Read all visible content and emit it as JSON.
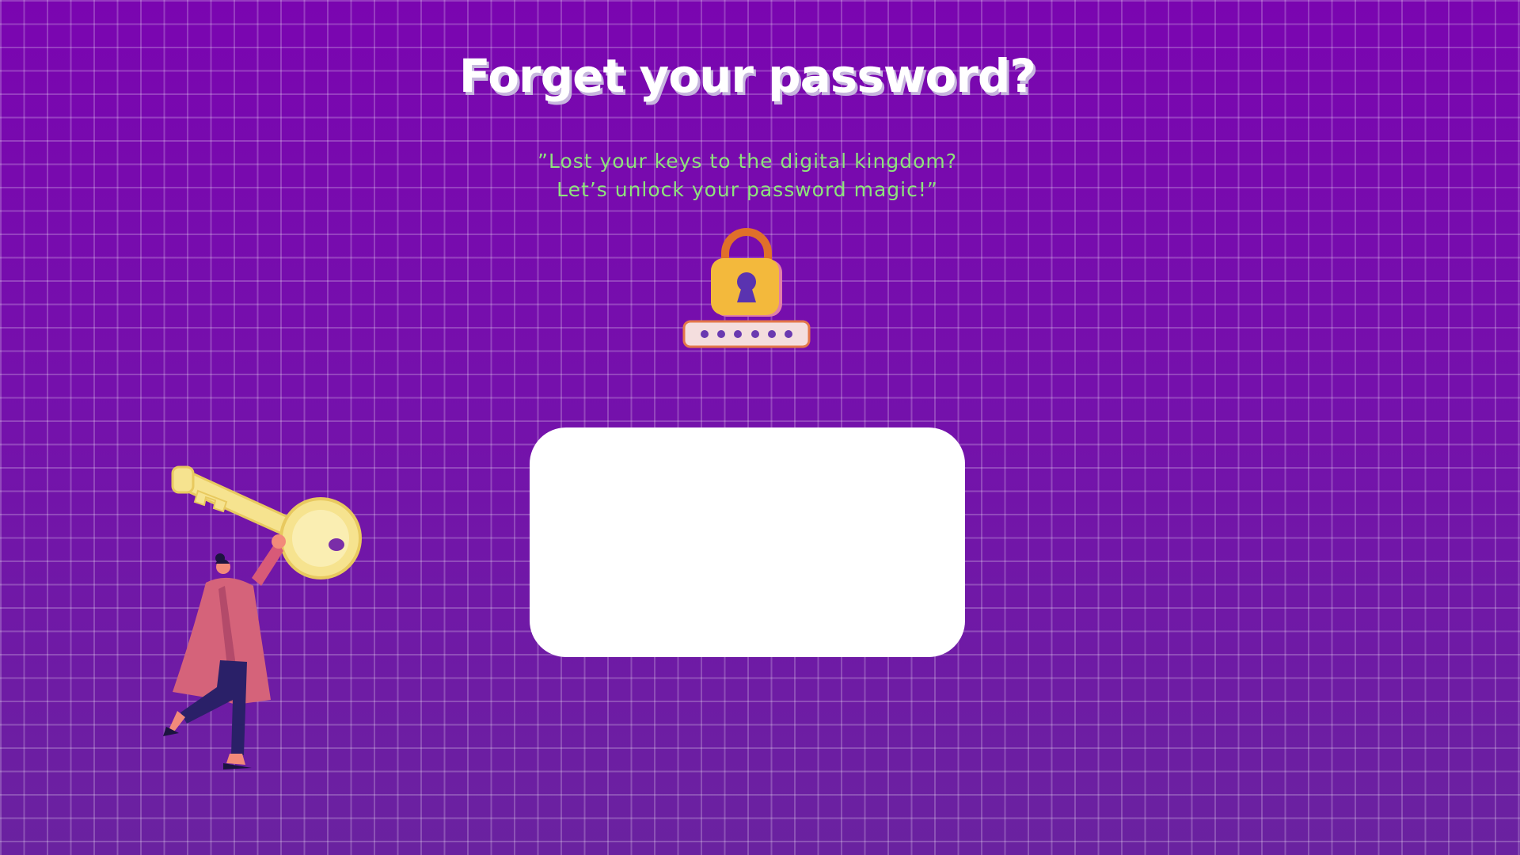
{
  "page": {
    "title": "Forget your password?",
    "subtitle_line1": "”Lost your keys to the digital kingdom?",
    "subtitle_line2": "Let’s unlock your password magic!”"
  },
  "icons": {
    "lock": "padlock-icon",
    "password_dots": "password-field-icon",
    "illustration": "person-carrying-key-illustration"
  },
  "colors": {
    "background": "#7a05b0",
    "title": "#ffffff",
    "subtitle": "#8ee27c",
    "lock_body": "#f3b93c",
    "lock_shackle": "#e0702a",
    "card": "#ffffff"
  }
}
